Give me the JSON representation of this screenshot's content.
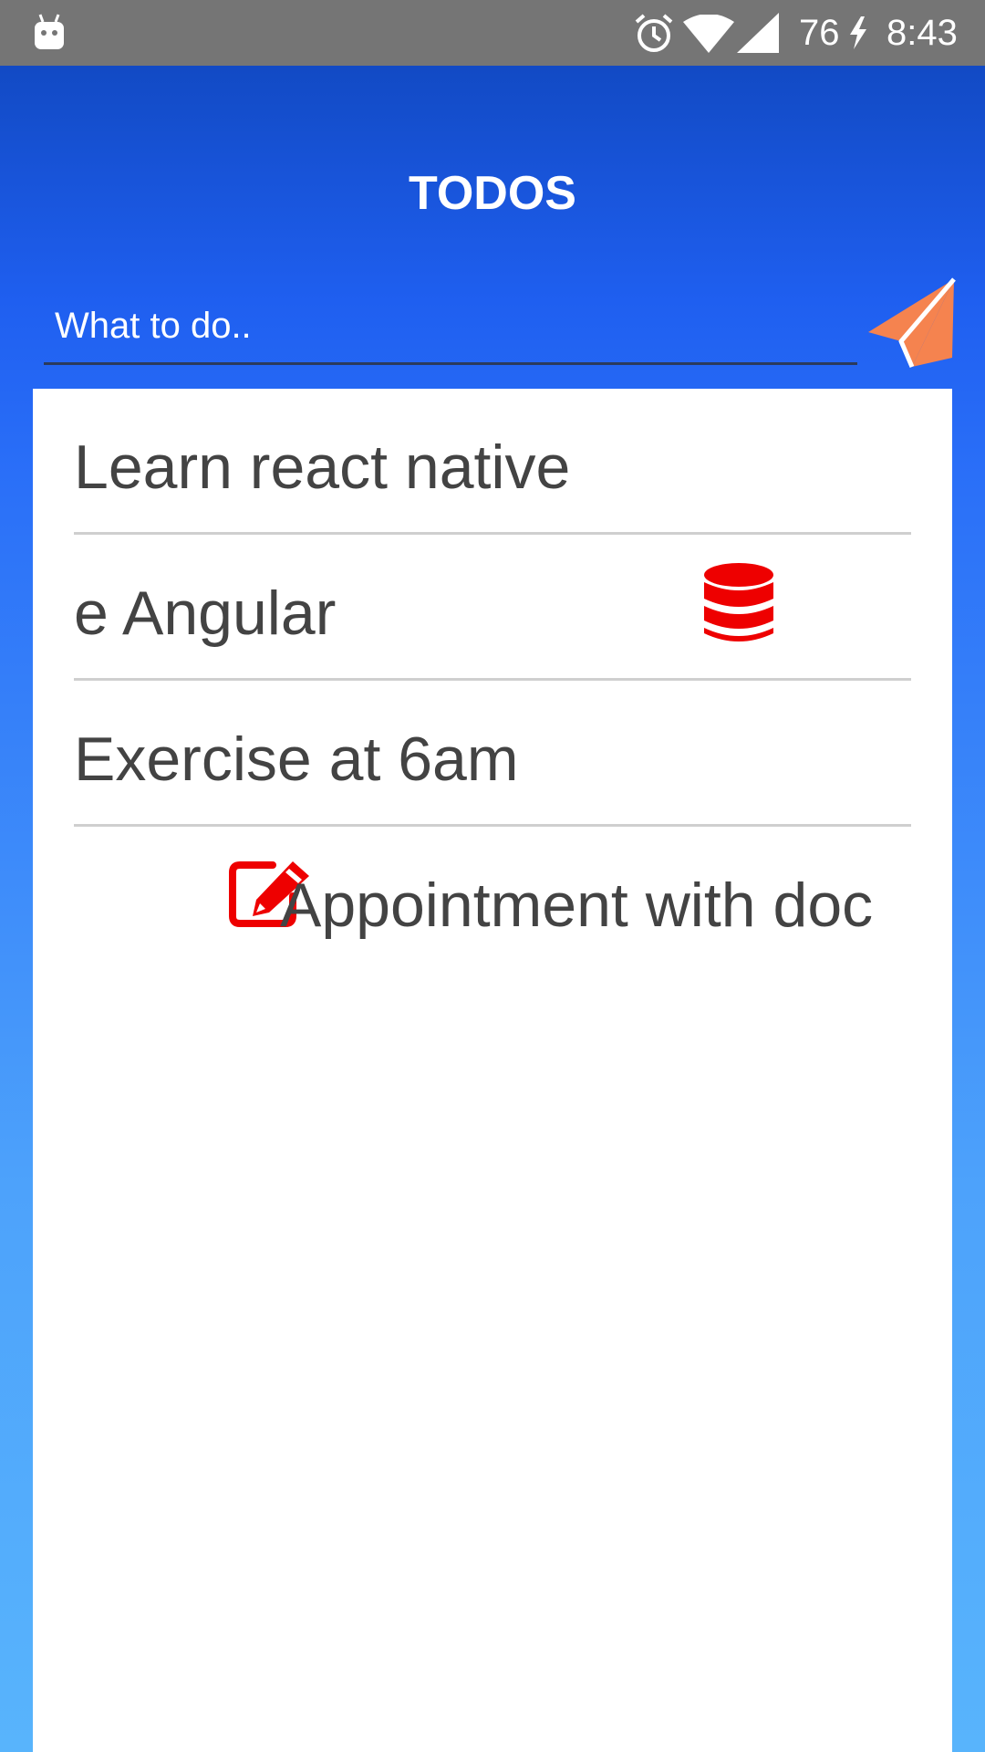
{
  "status_bar": {
    "battery_level": "76",
    "time": "8:43",
    "icons": [
      "android-icon",
      "alarm-icon",
      "wifi-icon",
      "signal-icon",
      "charging-bolt-icon"
    ]
  },
  "header": {
    "title": "TODOS"
  },
  "input": {
    "placeholder": "What to do..",
    "value": "",
    "send_icon": "paper-plane-icon",
    "send_color": "#f5834f"
  },
  "todos": [
    {
      "text": "Learn react native"
    },
    {
      "text": "e Angular",
      "swipe_action_icon": "database-delete-icon"
    },
    {
      "text": "Exercise at 6am"
    },
    {
      "text": "Appointment with doc",
      "swipe_action_icon": "edit-icon"
    }
  ],
  "colors": {
    "accent_red": "#ee0000",
    "status_bar": "#757575",
    "gradient_top": "#0e44b8",
    "gradient_bottom": "#58b4fc",
    "text": "#434343"
  }
}
